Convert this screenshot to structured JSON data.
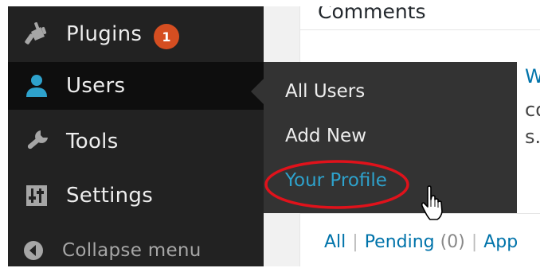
{
  "sidebar": {
    "items": [
      {
        "label": "Plugins",
        "icon": "plugin-icon",
        "badge": "1"
      },
      {
        "label": "Users",
        "icon": "user-icon"
      },
      {
        "label": "Tools",
        "icon": "wrench-icon"
      },
      {
        "label": "Settings",
        "icon": "settings-icon"
      }
    ],
    "collapse_label": "Collapse menu"
  },
  "submenu": {
    "items": [
      {
        "label": "All Users"
      },
      {
        "label": "Add New"
      },
      {
        "label": "Your Profile"
      }
    ]
  },
  "content": {
    "title": "Comments",
    "peek_lines": [
      "Wo",
      "co",
      "s. T"
    ],
    "filter": {
      "all_label": "All",
      "pending_label": "Pending",
      "pending_count": "(0)",
      "approved_label": "App"
    }
  },
  "colors": {
    "sidebar_bg": "#222222",
    "submenu_bg": "#333333",
    "active_link": "#2ea2cc",
    "badge": "#d54e21",
    "highlight_ring": "#e0121b"
  }
}
